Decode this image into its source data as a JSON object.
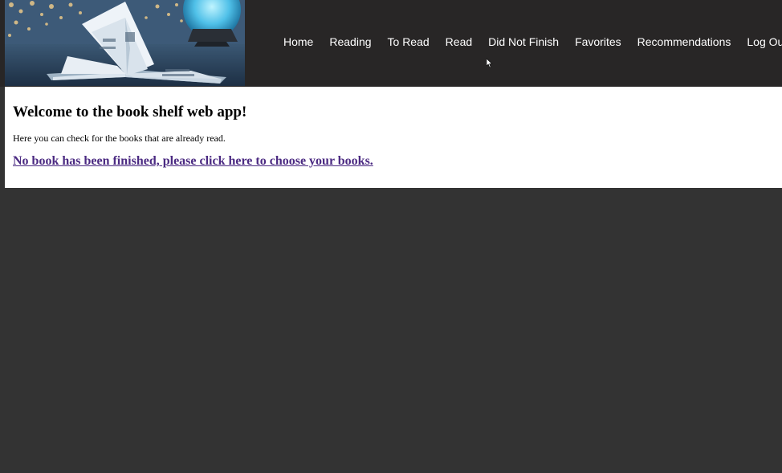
{
  "header": {
    "banner_image": "open-book-with-bokeh-lights-and-glowing-globe"
  },
  "nav": {
    "items": [
      {
        "label": "Home"
      },
      {
        "label": "Reading"
      },
      {
        "label": "To Read"
      },
      {
        "label": "Read"
      },
      {
        "label": "Did Not Finish"
      },
      {
        "label": "Favorites"
      },
      {
        "label": "Recommendations"
      },
      {
        "label": "Log Out"
      }
    ]
  },
  "main": {
    "heading": "Welcome to the book shelf web app!",
    "description": "Here you can check for the books that are already read.",
    "empty_link": "No book has been finished, please click here to choose your books."
  },
  "colors": {
    "page_background": "#333333",
    "header_background": "#282626",
    "nav_text": "#ffffff",
    "link": "#4b2a82",
    "content_background": "#ffffff"
  }
}
